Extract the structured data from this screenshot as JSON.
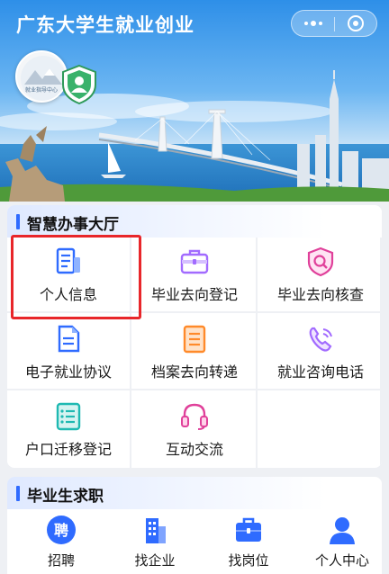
{
  "header": {
    "title": "广东大学生就业创业",
    "logo_caption": "就业指导中心"
  },
  "smart_service": {
    "title": "智慧办事大厅",
    "items": [
      {
        "label": "个人信息",
        "icon": "profile-document-icon",
        "selected": true
      },
      {
        "label": "毕业去向登记",
        "icon": "briefcase-icon"
      },
      {
        "label": "毕业去向核查",
        "icon": "shield-search-icon"
      },
      {
        "label": "电子就业协议",
        "icon": "edit-document-icon"
      },
      {
        "label": "档案去向转递",
        "icon": "file-list-icon"
      },
      {
        "label": "就业咨询电话",
        "icon": "phone-icon"
      },
      {
        "label": "户口迁移登记",
        "icon": "list-document-icon"
      },
      {
        "label": "互动交流",
        "icon": "headset-icon"
      }
    ]
  },
  "job_seeking": {
    "title": "毕业生求职",
    "items": [
      {
        "label": "招聘",
        "icon": "recruit-icon",
        "glyph": "聘"
      },
      {
        "label": "找企业",
        "icon": "building-icon"
      },
      {
        "label": "找岗位",
        "icon": "briefcase-icon"
      },
      {
        "label": "个人中心",
        "icon": "user-icon"
      }
    ]
  },
  "colors": {
    "accent": "#2f6bff",
    "highlight": "#e8262a",
    "purple": "#a26bff",
    "orange": "#ff8a2a",
    "teal": "#1fb9b2"
  }
}
